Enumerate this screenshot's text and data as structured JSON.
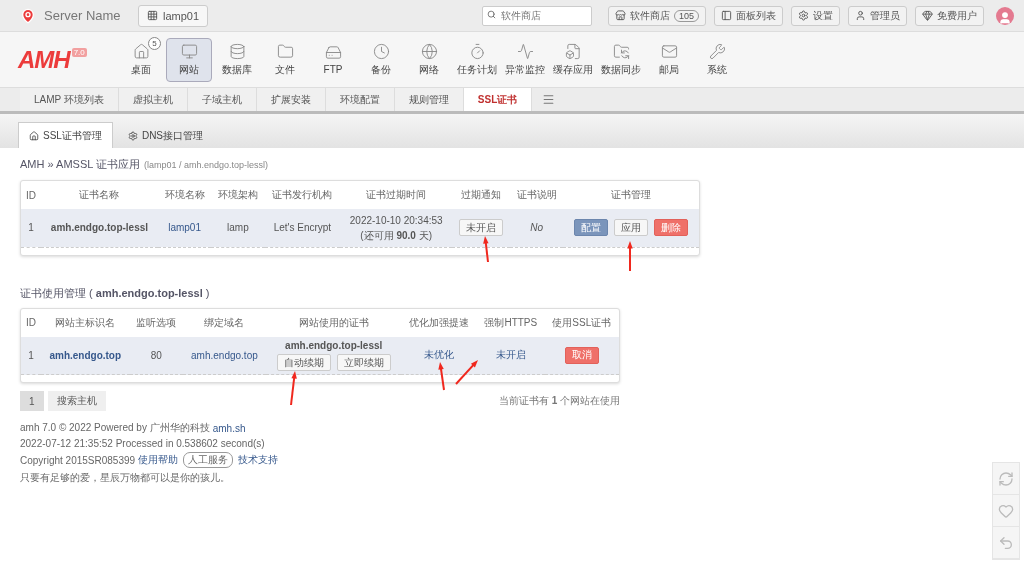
{
  "header": {
    "server_name": "Server Name",
    "env_button": "lamp01",
    "search": {
      "placeholder": "软件商店"
    },
    "buttons": [
      {
        "kind": "store",
        "label": "软件商店",
        "count": "105"
      },
      {
        "kind": "panel",
        "label": "面板列表"
      },
      {
        "kind": "settings",
        "label": "设置"
      },
      {
        "kind": "user",
        "label": "管理员"
      },
      {
        "kind": "vip",
        "label": "免费用户"
      }
    ]
  },
  "nav": {
    "logo": "AMH",
    "version": "7.0",
    "items": [
      {
        "label": "桌面",
        "selected": false,
        "badge": "5"
      },
      {
        "label": "网站",
        "selected": true
      },
      {
        "label": "数据库",
        "selected": false
      },
      {
        "label": "文件",
        "selected": false
      },
      {
        "label": "FTP",
        "selected": false
      },
      {
        "label": "备份",
        "selected": false
      },
      {
        "label": "网络",
        "selected": false
      },
      {
        "label": "任务计划",
        "selected": false
      },
      {
        "label": "异常监控",
        "selected": false
      },
      {
        "label": "缓存应用",
        "selected": false
      },
      {
        "label": "数据同步",
        "selected": false
      },
      {
        "label": "邮局",
        "selected": false
      },
      {
        "label": "系统",
        "selected": false
      }
    ]
  },
  "tabs": [
    {
      "label": "LAMP 环境列表",
      "selected": false
    },
    {
      "label": "虚拟主机",
      "selected": false
    },
    {
      "label": "子域主机",
      "selected": false
    },
    {
      "label": "扩展安装",
      "selected": false
    },
    {
      "label": "环境配置",
      "selected": false
    },
    {
      "label": "规则管理",
      "selected": false
    },
    {
      "label": "SSL证书",
      "selected": true
    }
  ],
  "subtabs": [
    {
      "label": "SSL证书管理",
      "selected": true
    },
    {
      "label": "DNS接口管理",
      "selected": false
    }
  ],
  "breadcrumb": {
    "title": "AMH » AMSSL 证书应用",
    "path": "(lamp01 / amh.endgo.top-lessl)"
  },
  "cert_table": {
    "columns": [
      "ID",
      "证书名称",
      "环境名称",
      "环境架构",
      "证书发行机构",
      "证书过期时间",
      "过期通知",
      "证书说明",
      "证书管理"
    ],
    "rows": [
      {
        "id": "1",
        "name": "amh.endgo.top-lessl",
        "env": "lamp01",
        "arch": "lamp",
        "issuer": "Let's Encrypt",
        "expiry": "2022-10-10 20:34:53",
        "remaining": "(还可用 **90.0** 天)",
        "notify": "未开启",
        "note": "No",
        "actions": [
          {
            "label": "配置",
            "kind": "primary"
          },
          {
            "label": "应用",
            "kind": "default"
          },
          {
            "label": "删除",
            "kind": "danger"
          }
        ]
      }
    ]
  },
  "usage": {
    "title": "证书使用管理 ( **amh.endgo.top-lessl** )",
    "columns": [
      "ID",
      "网站主标识名",
      "监听选项",
      "绑定域名",
      "网站使用的证书",
      "优化加强提速",
      "强制HTTPS",
      "使用SSL证书"
    ],
    "rows": [
      {
        "id": "1",
        "site": "amh.endgo.top",
        "port": "80",
        "domain": "amh.endgo.top",
        "cert": "amh.endgo.top-lessl",
        "renew_buttons": [
          "自动续期",
          "立即续期"
        ],
        "optimize": "未优化",
        "https": "未开启",
        "action": "取消"
      }
    ],
    "pager": {
      "page": "1",
      "search_button": "搜索主机"
    },
    "summary": "当前证书有 **1** 个网站在使用"
  },
  "footer": {
    "line1": "amh 7.0 © 2022 Powered by 广州华的科技",
    "line1_link": "amh.sh",
    "line2": "2022-07-12 21:35:52 Processed in 0.538602 second(s)",
    "line3": "Copyright 2015SR085399",
    "help_link": "使用帮助",
    "service_badge": "人工服务",
    "support_link": "技术支持",
    "quote": "只要有足够的爱，星辰万物都可以是你的孩儿。"
  }
}
